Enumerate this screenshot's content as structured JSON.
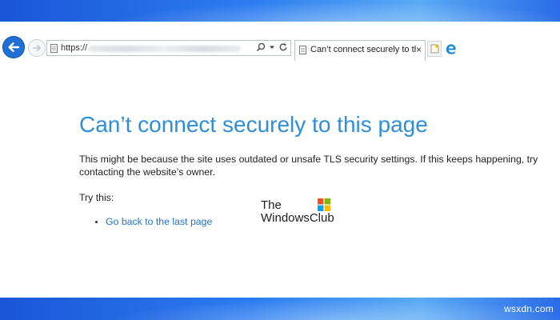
{
  "address_bar": {
    "url_prefix": "https://"
  },
  "tab": {
    "title": "Can’t connect securely to th…",
    "close": "×"
  },
  "error": {
    "title": "Can’t connect securely to this page",
    "description": "This might be because the site uses outdated or unsafe TLS security settings. If this keeps happening, try contacting the website’s owner.",
    "try_label": "Try this:",
    "suggestions": [
      "Go back to the last page"
    ]
  },
  "watermark": {
    "line1": "The",
    "line2": "WindowsClub",
    "site": "wsxdn.com"
  },
  "icons": [
    "back-arrow-icon",
    "forward-icon",
    "page-icon",
    "search-icon",
    "dropdown-icon",
    "refresh-icon",
    "new-tab-icon",
    "edge-icon",
    "windows-logo-icon"
  ],
  "colors": {
    "title_blue": "#2e8fd8",
    "link_blue": "#1e73c9",
    "back_button": "#1f6fd6",
    "band_blue": "#2c7cf0"
  }
}
